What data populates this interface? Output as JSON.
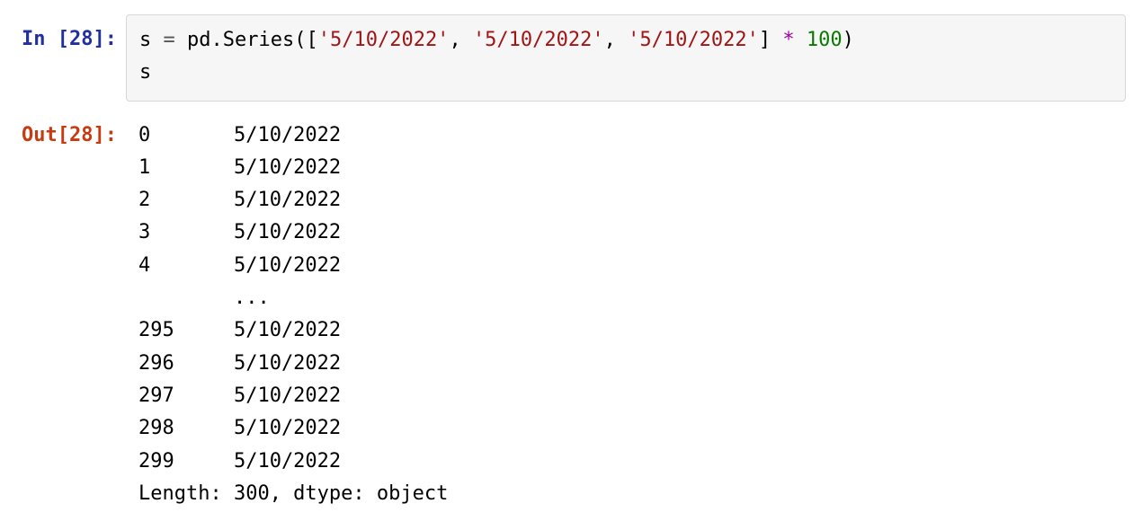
{
  "cell": {
    "exec_count": "28",
    "in_prompt": "In [28]:",
    "out_prompt": "Out[28]:",
    "code": {
      "line1": {
        "s": "s",
        "sp1": " ",
        "eq": "=",
        "sp2": " ",
        "pd": "pd",
        "dot": ".",
        "series": "Series",
        "lpar": "(",
        "lbr": "[",
        "q1": "'5/10/2022'",
        "c1": ",",
        "sp3": " ",
        "q2": "'5/10/2022'",
        "c2": ",",
        "sp4": " ",
        "q3": "'5/10/2022'",
        "rbr": "]",
        "sp5": " ",
        "star": "*",
        "sp6": " ",
        "hundred": "100",
        "rpar": ")"
      },
      "line2": "s"
    },
    "output": {
      "rows": [
        {
          "idx": "0",
          "val": "5/10/2022"
        },
        {
          "idx": "1",
          "val": "5/10/2022"
        },
        {
          "idx": "2",
          "val": "5/10/2022"
        },
        {
          "idx": "3",
          "val": "5/10/2022"
        },
        {
          "idx": "4",
          "val": "5/10/2022"
        }
      ],
      "ellipsis_idx": "",
      "ellipsis_val": "...   ",
      "rows_tail": [
        {
          "idx": "295",
          "val": "5/10/2022"
        },
        {
          "idx": "296",
          "val": "5/10/2022"
        },
        {
          "idx": "297",
          "val": "5/10/2022"
        },
        {
          "idx": "298",
          "val": "5/10/2022"
        },
        {
          "idx": "299",
          "val": "5/10/2022"
        }
      ],
      "summary": "Length: 300, dtype: object"
    }
  }
}
